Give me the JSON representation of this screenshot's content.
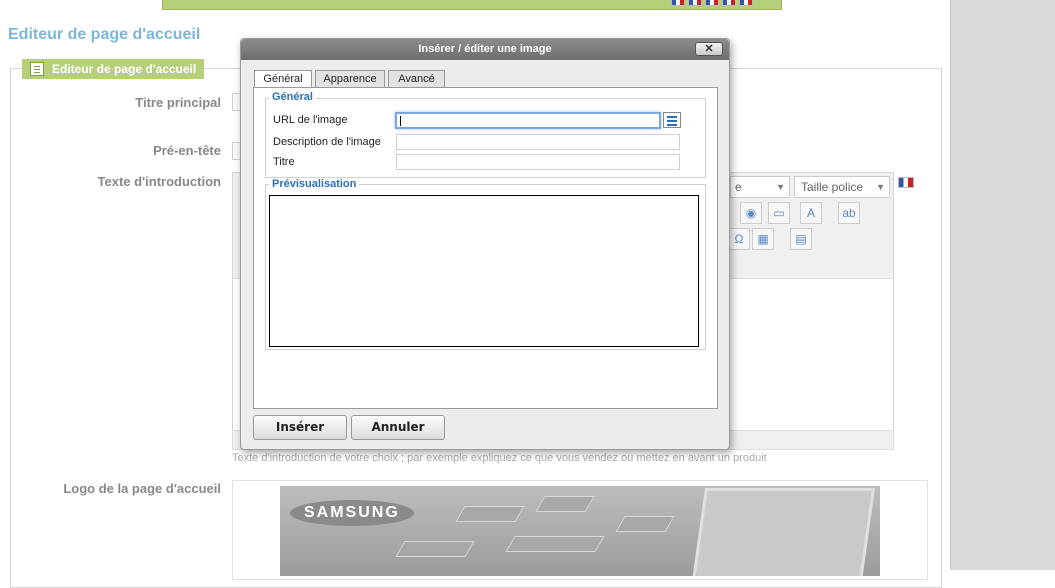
{
  "page": {
    "title": "Editeur de page d'accueil",
    "section_legend": "Editeur de page d'accueil",
    "labels": {
      "main_title": "Titre principal",
      "pre_header": "Pré-en-tête",
      "intro_text": "Texte d'introduction",
      "logo": "Logo de la page d'accueil"
    },
    "intro_hint": "Texte d'introduction de votre choix ; par exemple expliquez ce que vous vendez ou mettez en avant un produit",
    "font_size_select": "Taille police",
    "font_family_stub": "e",
    "logo_brand": "SAMSUNG"
  },
  "dialog": {
    "title": "Insérer / éditer une image",
    "close": "✕",
    "tabs": [
      {
        "label": "Général"
      },
      {
        "label": "Apparence"
      },
      {
        "label": "Avancé"
      }
    ],
    "general_group": "Général",
    "fields": {
      "url_label": "URL de l'image",
      "url_value": "",
      "description_label": "Description de l'image",
      "description_value": "",
      "title_label": "Titre",
      "title_value": ""
    },
    "preview_group": "Prévisualisation",
    "buttons": {
      "insert": "Insérer",
      "cancel": "Annuler"
    }
  },
  "colors": {
    "accent_green": "#b6d07a",
    "title_blue": "#7cb7d9",
    "group_blue": "#2a6fb8"
  }
}
